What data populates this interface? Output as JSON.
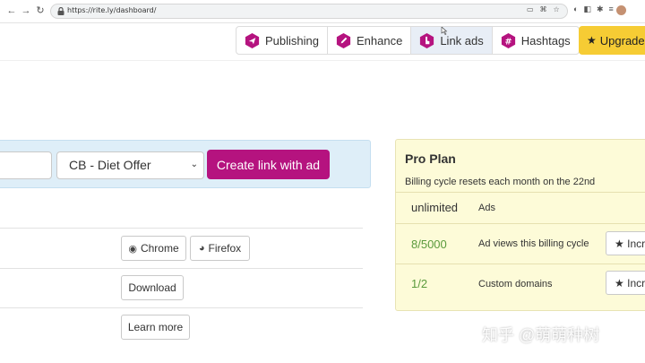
{
  "browser": {
    "url": "https://rite.ly/dashboard/",
    "nav_back": "←",
    "nav_forward": "→",
    "nav_reload": "↻",
    "url_icons": "▭⌘☆",
    "ext_icons": "◐◧✱≡"
  },
  "tabs": [
    {
      "label": "Publishing",
      "icon": "paper-plane-icon",
      "color": "#b5137f"
    },
    {
      "label": "Enhance",
      "icon": "pencil-icon",
      "color": "#b5137f"
    },
    {
      "label": "Link ads",
      "icon": "pointer-hand-icon",
      "color": "#b5137f",
      "active": true
    },
    {
      "label": "Hashtags",
      "icon": "hashtag-icon",
      "color": "#b5137f"
    }
  ],
  "upgrade": {
    "label": "Upgrade",
    "icon": "★",
    "color": "#f6cc34"
  },
  "create": {
    "link_placeholder": "",
    "offer_selected": "CB - Diet Offer",
    "offer_caret": "⌄",
    "button_label": "Create link with ad",
    "button_color": "#b5137f"
  },
  "rows": [
    {
      "buttons": [
        {
          "label": "Chrome",
          "icon": "chrome-icon",
          "glyph": "◉"
        },
        {
          "label": "Firefox",
          "icon": "firefox-icon",
          "glyph": "◕"
        }
      ]
    },
    {
      "buttons": [
        {
          "label": "Download"
        }
      ]
    },
    {
      "buttons": [
        {
          "label": "Learn more"
        }
      ]
    }
  ],
  "plan": {
    "title": "Pro Plan",
    "subtitle": "Billing cycle resets each month on the 22nd",
    "stats": [
      {
        "value": "unlimited",
        "label": "Ads",
        "value_color": "#333333"
      },
      {
        "value": "8/5000",
        "label": "Ad views this billing cycle",
        "value_color": "#5a9a3c",
        "button": "Incr"
      },
      {
        "value": "1/2",
        "label": "Custom domains",
        "value_color": "#5a9a3c",
        "button": "Incr"
      }
    ],
    "button_icon": "★"
  },
  "watermark": "知乎 @萌萌种树"
}
